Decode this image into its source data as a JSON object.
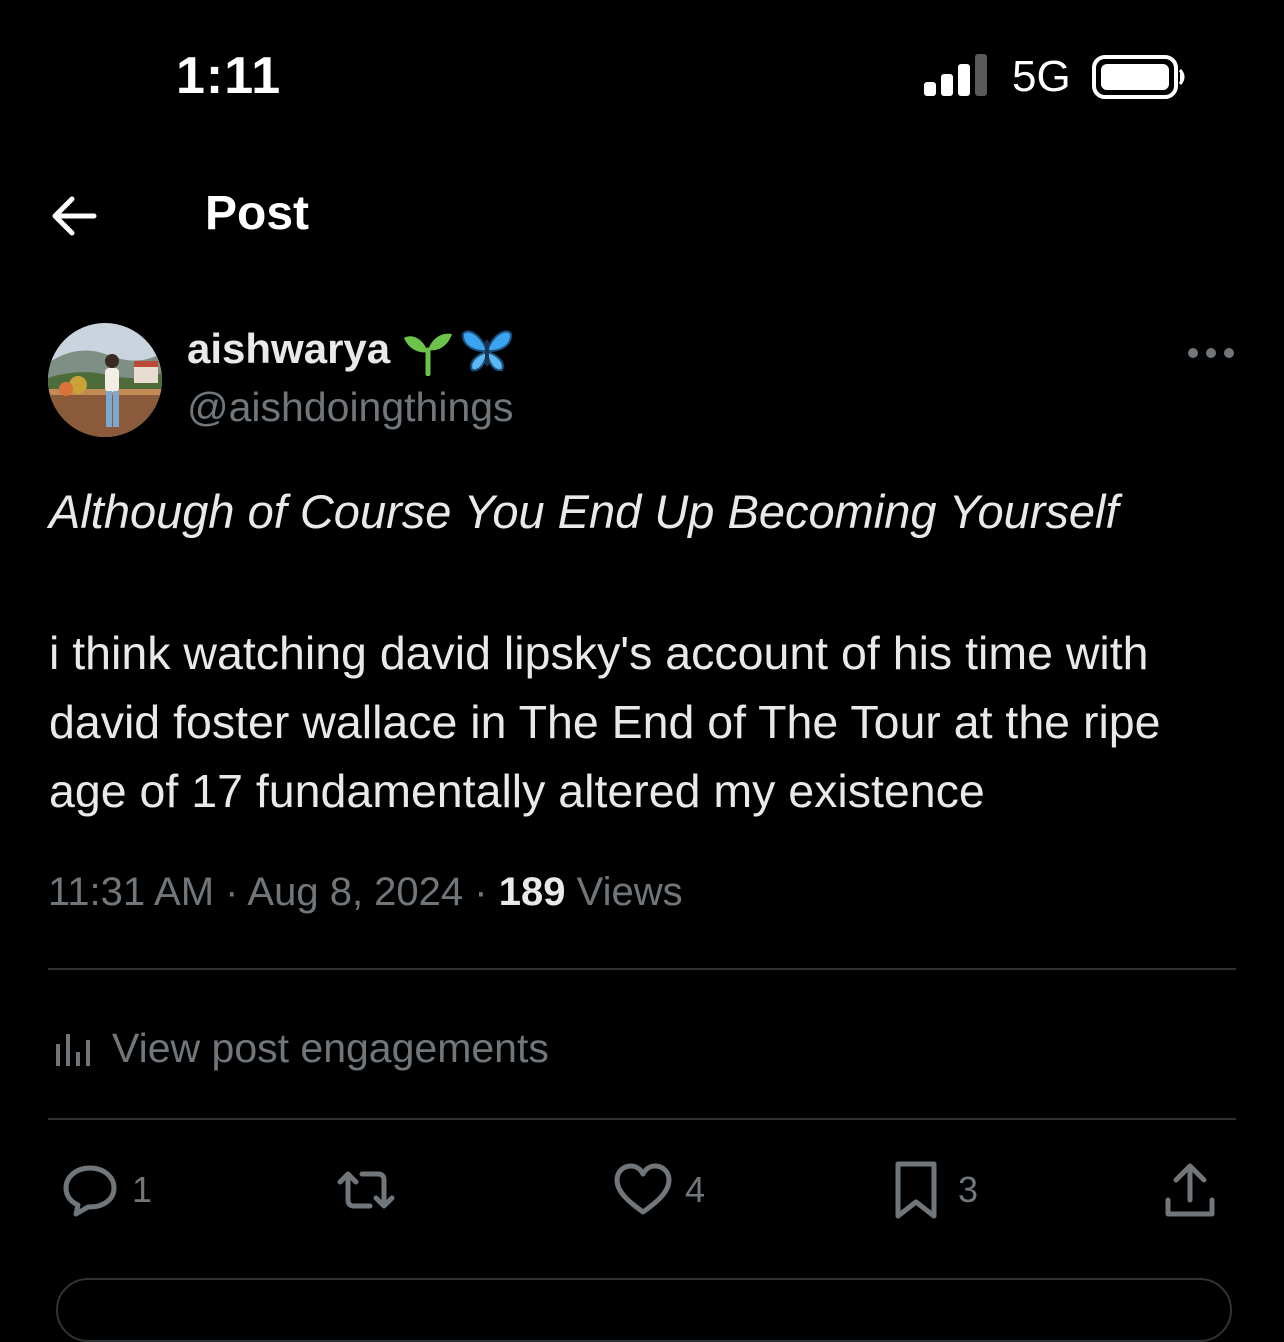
{
  "status_bar": {
    "time": "1:11",
    "network": "5G",
    "signal_icon": "cellular-signal-icon",
    "battery_icon": "battery-icon"
  },
  "nav": {
    "back_icon": "arrow-left-icon",
    "title": "Post"
  },
  "author": {
    "display_name": "aishwarya",
    "emojis": [
      "sprout-emoji",
      "butterfly-emoji"
    ],
    "handle": "@aishdoingthings",
    "more_icon": "more-horizontal-icon"
  },
  "post": {
    "title": "Although of Course You End Up Becoming Yourself",
    "body": "i think watching david lipsky's account of his time with david foster wallace in The End of The Tour at the ripe age of 17 fundamentally altered my existence",
    "time": "11:31 AM",
    "separator": "·",
    "date": "Aug 8, 2024",
    "views_count": "189",
    "views_label": "Views"
  },
  "engagements": {
    "icon": "analytics-icon",
    "label": "View post engagements"
  },
  "actions": {
    "reply": {
      "icon": "reply-icon",
      "count": "1"
    },
    "repost": {
      "icon": "repost-icon",
      "count": ""
    },
    "like": {
      "icon": "heart-icon",
      "count": "4"
    },
    "bookmark": {
      "icon": "bookmark-icon",
      "count": "3"
    },
    "share": {
      "icon": "share-icon"
    }
  },
  "colors": {
    "background": "#000000",
    "text_primary": "#e7e9ea",
    "text_secondary": "#71767b",
    "divider": "#2f3336",
    "sprout_green": "#6cc24a",
    "butterfly_blue": "#3ba3f0"
  }
}
